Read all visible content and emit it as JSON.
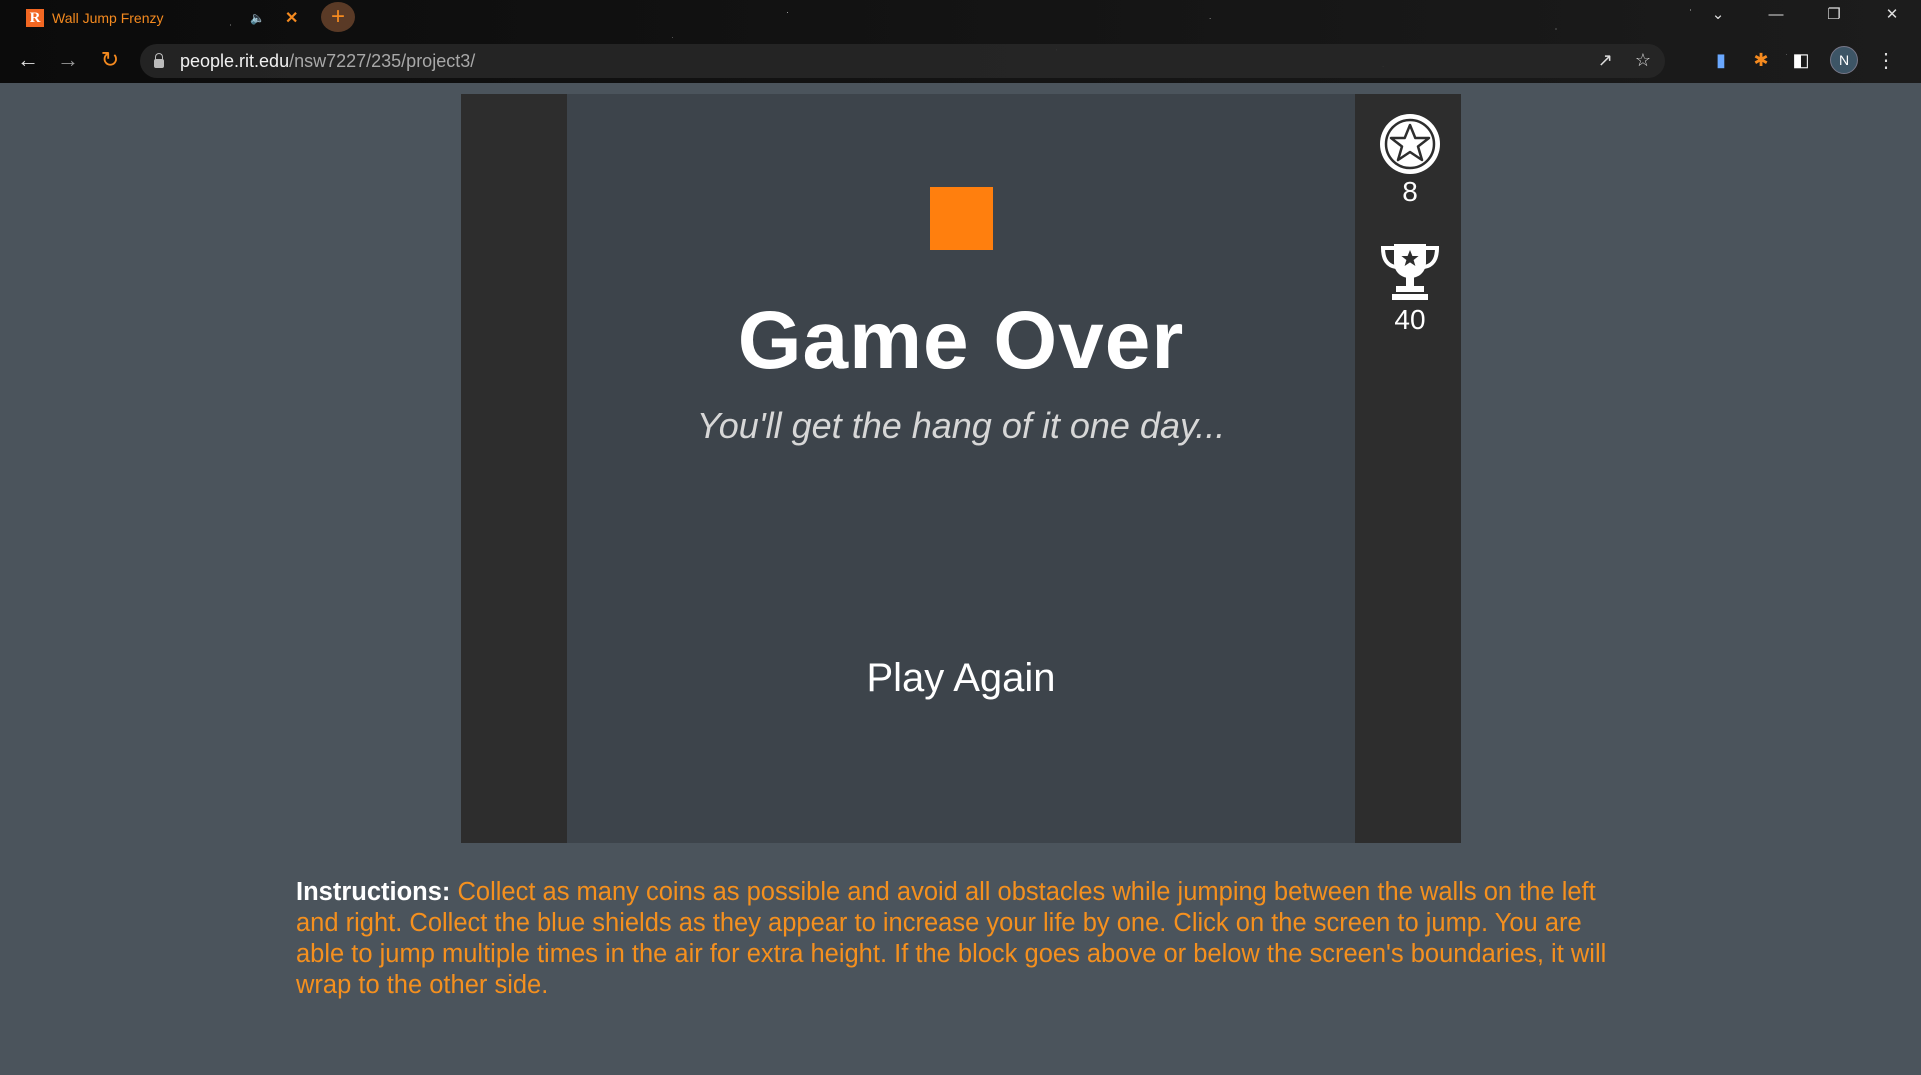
{
  "browser": {
    "tab_title": "Wall Jump Frenzy",
    "favicon_letter": "R",
    "audio_icon": "speaker-icon",
    "new_tab_label": "+",
    "url_host": "people.rit.edu",
    "url_path": "/nsw7227/235/project3/",
    "profile_initial": "N",
    "accent_color": "#f58a1f"
  },
  "game": {
    "title": "Game Over",
    "subtitle": "You'll get the hang of it one day...",
    "play_again_label": "Play Again",
    "coins": "8",
    "best_score": "40",
    "player_color": "#ff7f0e",
    "wall_color": "#2d2d2d",
    "background_color": "#3d444b"
  },
  "instructions": {
    "label": "Instructions:",
    "text": " Collect as many coins as possible and avoid all obstacles while jumping between the walls on the left and right. Collect the blue shields as they appear to increase your life by one. Click on the screen to jump. You are able to jump multiple times in the air for extra height. If the block goes above or below the screen's boundaries, it will wrap to the other side."
  }
}
